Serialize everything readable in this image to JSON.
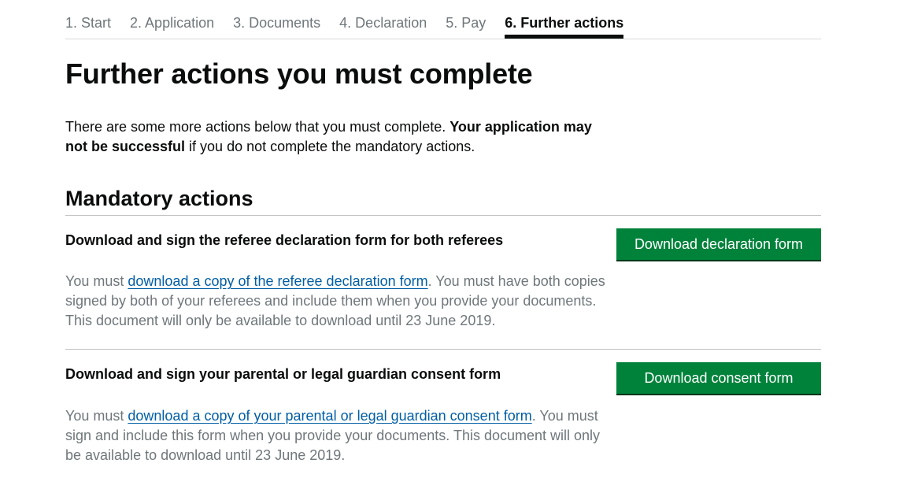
{
  "steps": [
    {
      "label": "1. Start"
    },
    {
      "label": "2. Application"
    },
    {
      "label": "3. Documents"
    },
    {
      "label": "4. Declaration"
    },
    {
      "label": "5. Pay"
    },
    {
      "label": "6. Further actions"
    }
  ],
  "page_title": "Further actions you must complete",
  "intro": {
    "text_before": "There are some more actions below that you must complete. ",
    "bold": "Your application may not be successful",
    "text_after": " if you do not complete the mandatory actions."
  },
  "section_heading": "Mandatory actions",
  "actions": [
    {
      "title": "Download and sign the referee declaration form for both referees",
      "body_prefix": "You must ",
      "link_text": "download a copy of the referee declaration form",
      "body_suffix": ". You must have both copies signed by both of your referees and include them when you provide your documents. This document will only be available to download until 23 June 2019.",
      "button_label": "Download declaration form"
    },
    {
      "title": "Download and sign your parental or legal guardian consent form",
      "body_prefix": "You must ",
      "link_text": "download a copy of your parental or legal guardian consent form",
      "body_suffix": ". You must sign and include this form when you provide your documents. This document will only be available to download until 23 June 2019.",
      "button_label": "Download consent form"
    }
  ],
  "colors": {
    "button_green": "#00823b",
    "link_blue": "#005ea5",
    "secondary_text": "#6f777b"
  }
}
